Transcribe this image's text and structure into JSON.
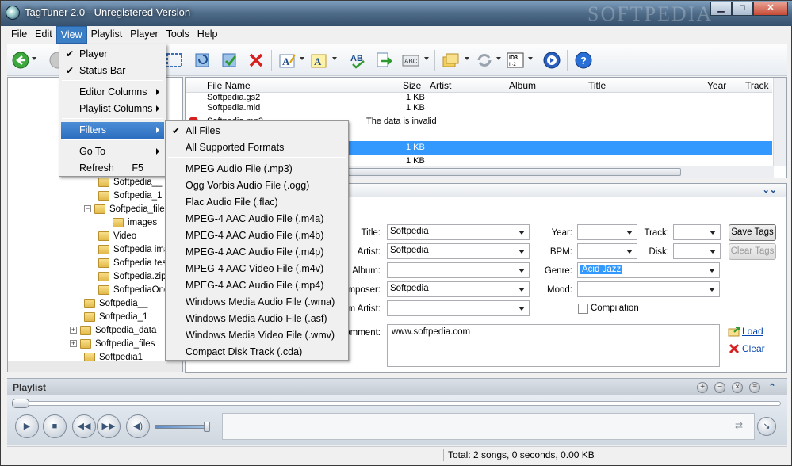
{
  "window": {
    "title": "TagTuner 2.0 - Unregistered Version",
    "watermark": "SOFTPEDIA",
    "minimize": "▁",
    "maximize": "□",
    "close": "✕"
  },
  "menubar": [
    "File",
    "Edit",
    "View",
    "Playlist",
    "Player",
    "Tools",
    "Help"
  ],
  "view_menu": {
    "items": [
      {
        "label": "Player",
        "checked": "✔"
      },
      {
        "label": "Status Bar",
        "checked": "✔"
      },
      {
        "label": "Editor Columns"
      },
      {
        "label": "Playlist Columns"
      },
      {
        "label": "Filters"
      },
      {
        "label": "Go To"
      },
      {
        "label": "Refresh",
        "shortcut": "F5"
      }
    ]
  },
  "filters_menu": {
    "checked": "✔",
    "items": [
      "All Files",
      "All Supported Formats",
      "MPEG Audio File (.mp3)",
      "Ogg Vorbis Audio File (.ogg)",
      "Flac Audio File (.flac)",
      "MPEG-4 AAC Audio File (.m4a)",
      "MPEG-4 AAC Audio File (.m4b)",
      "MPEG-4 AAC Audio File (.m4p)",
      "MPEG-4 AAC Video File (.m4v)",
      "MPEG-4 AAC Audio File (.mp4)",
      "Windows Media Audio File (.wma)",
      "Windows Media Audio File (.asf)",
      "Windows Media Video File (.wmv)",
      "Compact Disk Track (.cda)"
    ]
  },
  "tree": [
    "Softpedia__",
    "Softpedia_1",
    "Softpedia_files",
    "images",
    "Video",
    "Softpedia images",
    "Softpedia test",
    "Softpedia.zip",
    "SoftpediaOne",
    "Softpedia__",
    "Softpedia_1",
    "Softpedia_data",
    "Softpedia_files",
    "Softpedia1"
  ],
  "file_list": {
    "columns": [
      "File Name",
      "Size",
      "Artist",
      "Album",
      "Title",
      "Year",
      "Track"
    ],
    "rows": [
      {
        "name": "Softpedia.gs2",
        "size": "1 KB",
        "note": ""
      },
      {
        "name": "Softpedia.mid",
        "size": "1 KB",
        "note": ""
      },
      {
        "name": "Softpedia.mp3",
        "size": "",
        "note": "The data is invalid"
      },
      {
        "name": "",
        "size": "1 KB",
        "note": ""
      },
      {
        "name": "",
        "size": "1 KB",
        "note": ""
      }
    ]
  },
  "tag_editor": {
    "title_label": "Title:",
    "title_value": "Softpedia",
    "artist_label": "Artist:",
    "artist_value": "Softpedia",
    "album_label": "Album:",
    "album_value": "",
    "composer_label": "omposer:",
    "composer_value": "Softpedia",
    "album_artist_label": "m Artist:",
    "album_artist_value": "",
    "comment_label": "omment:",
    "comment_value": "www.softpedia.com",
    "year_label": "Year:",
    "year_value": "",
    "bpm_label": "BPM:",
    "bpm_value": "",
    "genre_label": "Genre:",
    "genre_value": "Acid Jazz",
    "mood_label": "Mood:",
    "mood_value": "",
    "track_label": "Track:",
    "track_value": "",
    "disk_label": "Disk:",
    "disk_value": "",
    "compilation_label": "Compilation",
    "save_tags": "Save Tags",
    "clear_tags": "Clear Tags",
    "load_link": "Load",
    "clear_link": "Clear"
  },
  "playlist": {
    "label": "Playlist"
  },
  "status": {
    "total": "Total: 2 songs, 0 seconds, 0.00 KB"
  },
  "colors": {
    "selection": "#3399ff",
    "menu_highlight": "#2d6fbf",
    "link": "#0645ad"
  }
}
